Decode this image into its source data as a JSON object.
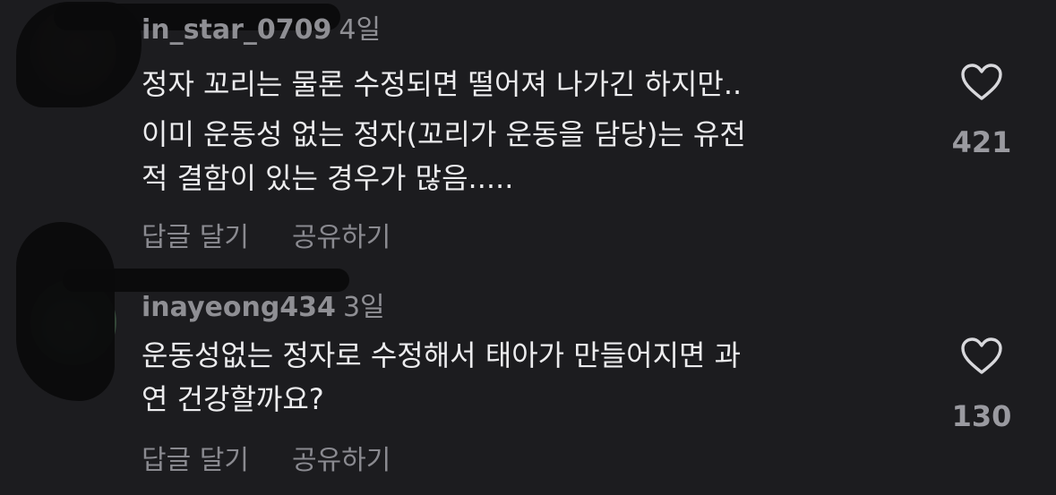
{
  "comments": [
    {
      "username": "in_star_0709",
      "time": "4일",
      "paragraphs": [
        [
          "정자 꼬리는 물론 수정되면 떨어져 나가긴 하지만.."
        ],
        [
          "이미 운동성 없는 정자(꼬리가 운동을 담당)는 유전",
          "적 결함이 있는 경우가 많음....."
        ]
      ],
      "reply_label": "답글 달기",
      "share_label": "공유하기",
      "like_count": "421",
      "like_icon": "heart-outline-icon"
    },
    {
      "username": "inayeong434",
      "time": "3일",
      "paragraphs": [
        [
          "운동성없는 정자로 수정해서 태아가 만들어지면 과",
          "연 건강할까요?"
        ]
      ],
      "reply_label": "답글 달기",
      "share_label": "공유하기",
      "like_count": "130",
      "like_icon": "heart-outline-icon"
    }
  ],
  "colors": {
    "background": "#1c1c1f",
    "body_text": "#ececee",
    "meta_text": "#8f8f94",
    "heart_stroke": "#d8d8dc"
  }
}
